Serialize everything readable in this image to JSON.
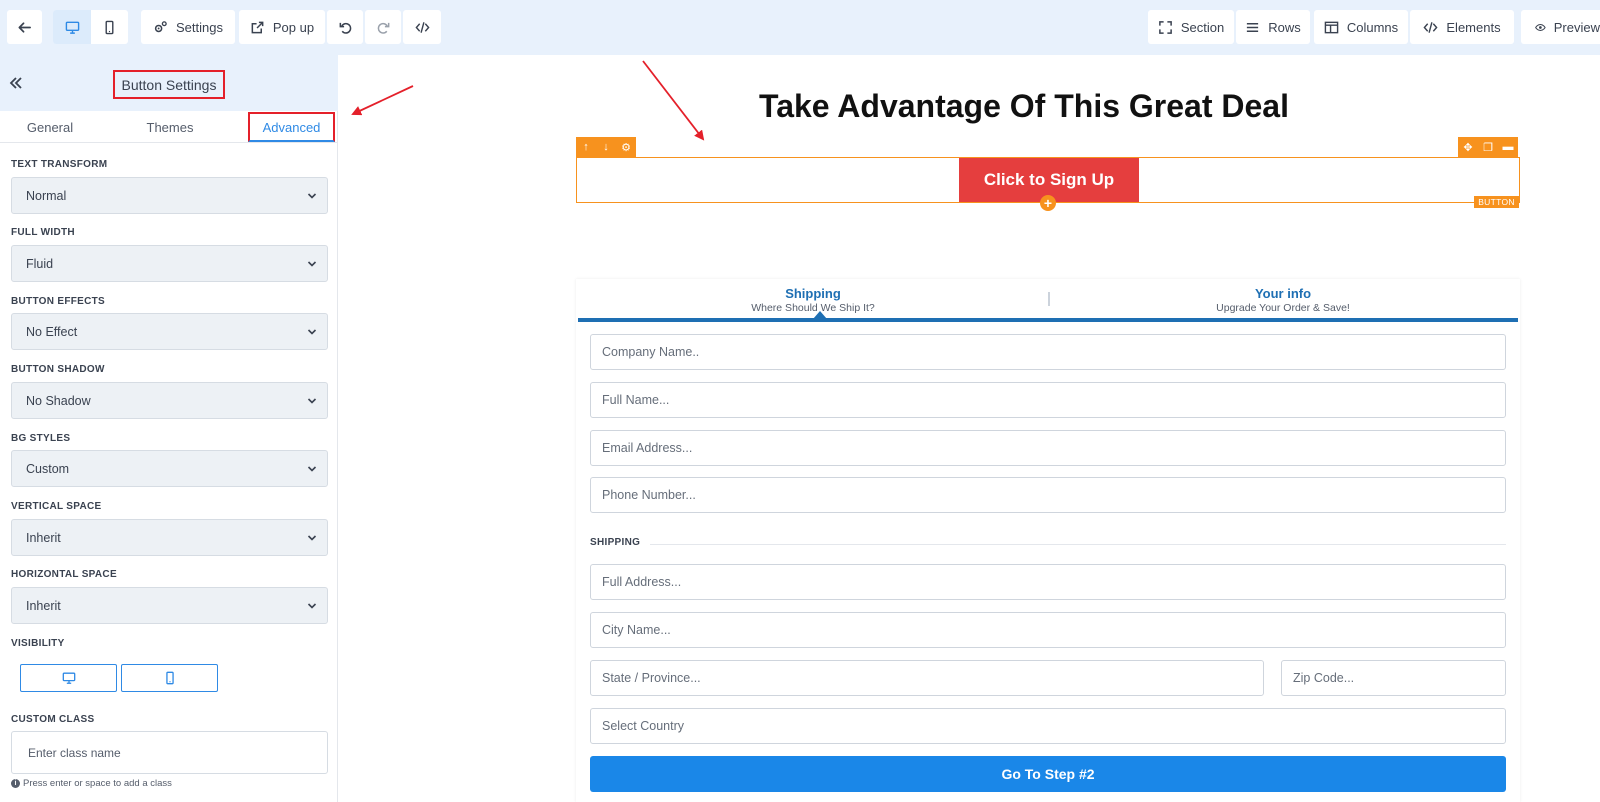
{
  "toolbar": {
    "settings_label": "Settings",
    "popup_label": "Pop up",
    "section_label": "Section",
    "rows_label": "Rows",
    "columns_label": "Columns",
    "elements_label": "Elements",
    "preview_label": "Preview"
  },
  "panel": {
    "title": "Button Settings",
    "tabs": [
      {
        "label": "General"
      },
      {
        "label": "Themes"
      },
      {
        "label": "Advanced"
      }
    ],
    "fields": [
      {
        "label": "TEXT TRANSFORM",
        "value": "Normal"
      },
      {
        "label": "FULL WIDTH",
        "value": "Fluid"
      },
      {
        "label": "BUTTON EFFECTS",
        "value": "No Effect"
      },
      {
        "label": "BUTTON SHADOW",
        "value": "No Shadow"
      },
      {
        "label": "BG STYLES",
        "value": "Custom"
      },
      {
        "label": "VERTICAL SPACE",
        "value": "Inherit"
      },
      {
        "label": "HORIZONTAL SPACE",
        "value": "Inherit"
      }
    ],
    "visibility_label": "VISIBILITY",
    "custom_class_label": "CUSTOM CLASS",
    "custom_class_placeholder": "Enter class name",
    "custom_class_hint": "Press enter or space to add a class"
  },
  "canvas": {
    "headline": "Take Advantage Of This Great Deal",
    "cta_label": "Click to Sign Up",
    "element_tag": "BUTTON",
    "steps": [
      {
        "title": "Shipping",
        "subtitle": "Where Should We Ship It?"
      },
      {
        "title": "Your info",
        "subtitle": "Upgrade Your Order & Save!"
      }
    ],
    "inputs": {
      "company": "Company Name..",
      "full_name": "Full Name...",
      "email": "Email Address...",
      "phone": "Phone Number...",
      "address": "Full Address...",
      "city": "City Name...",
      "state": "State / Province...",
      "zip": "Zip Code...",
      "country": "Select Country"
    },
    "shipping_label": "SHIPPING",
    "submit_label": "Go To Step #2"
  },
  "colors": {
    "accent_blue": "#2f8ae5",
    "cta_red": "#e53e3e",
    "selection_orange": "#f7921e",
    "step_blue": "#1e6fb3",
    "submit_blue": "#1a87e8",
    "annotation_red": "#e4202a"
  }
}
